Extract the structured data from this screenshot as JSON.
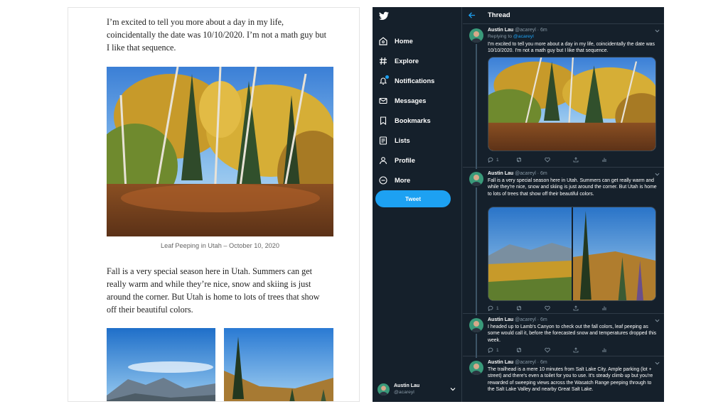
{
  "blog": {
    "paragraph1": "I’m excited to tell you more about a day in my life, coincidentally the date was 10/10/2020. I’m not a math guy but I like that sequence.",
    "caption": "Leaf Peeping in Utah – October 10, 2020",
    "paragraph2": "Fall is a very special season here in Utah. Summers can get really warm and while they’re nice, snow and skiing is just around the corner. But Utah is home to lots of trees that show off their beautiful colors."
  },
  "twitter": {
    "accent": "#1da1f2",
    "background": "#15202b",
    "nav": [
      {
        "label": "Home",
        "icon": "home-icon"
      },
      {
        "label": "Explore",
        "icon": "hashtag-icon"
      },
      {
        "label": "Notifications",
        "icon": "bell-icon"
      },
      {
        "label": "Messages",
        "icon": "mail-icon"
      },
      {
        "label": "Bookmarks",
        "icon": "bookmark-icon"
      },
      {
        "label": "Lists",
        "icon": "list-icon"
      },
      {
        "label": "Profile",
        "icon": "person-icon"
      },
      {
        "label": "More",
        "icon": "more-circle-icon"
      }
    ],
    "tweet_button": "Tweet",
    "account": {
      "name": "Austin Lau",
      "handle": "@acareyl"
    },
    "thread_title": "Thread",
    "tweets": [
      {
        "name": "Austin Lau",
        "meta": "@acareyl · 6m",
        "replying_prefix": "Replying to",
        "replying_user": "@acareyl",
        "text": "I'm excited to tell you more about a day in my life, coincidentally the date was 10/10/2020. I'm not a math guy but I like that sequence.",
        "reply_count": "1"
      },
      {
        "name": "Austin Lau",
        "meta": "@acareyl · 6m",
        "text": "Fall is a very special season here in Utah. Summers can get really warm and while they're nice, snow and skiing is just around the corner. But Utah is home to lots of trees that show off their beautiful colors.",
        "reply_count": "1"
      },
      {
        "name": "Austin Lau",
        "meta": "@acareyl · 6m",
        "text": "I headed up to Lamb's Canyon to check out the fall colors, leaf peeping as some would call it, before the forecasted snow and temperatures dropped this week.",
        "reply_count": "1"
      },
      {
        "name": "Austin Lau",
        "meta": "@acareyl · 6m",
        "text": "The trailhead is a mere 10 minutes from Salt Lake City. Ample parking (lot + street) and there's even a toilet for you to use. It's steady climb up but you're rewarded of sweeping views across the Wasatch Range peeping through to the Salt Lake Valley and nearby Great Salt Lake."
      }
    ]
  }
}
